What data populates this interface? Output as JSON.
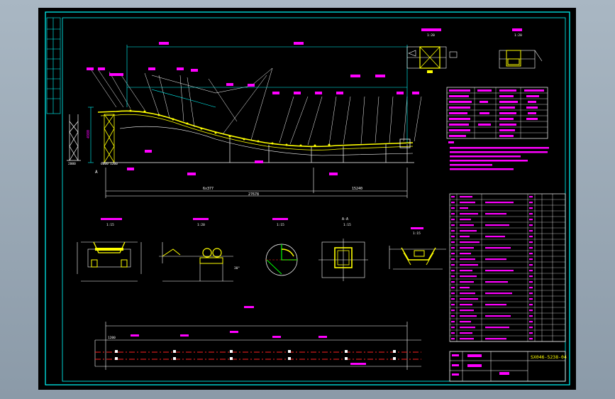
{
  "drawing": {
    "drawing_number": "SX046-5238-04"
  },
  "elevation": {
    "dimensions": {
      "total_length": "27678",
      "left_segment": "6x377",
      "right_segment": "15240",
      "base_left": "6000",
      "base_left2": "1200",
      "left_height": "2000",
      "vertical_height": "4980",
      "bottom_left": "1200"
    },
    "section_marker": "A"
  },
  "details": {
    "top_detail_scale": "1:20",
    "top_right_scale": "1:20",
    "detail_scales": [
      "1:15",
      "1:20",
      "1:15",
      "1:15",
      "1:15"
    ],
    "section_label_aa": "A-A"
  },
  "plan": {
    "left_dim": "1200",
    "angle_mark": "30°"
  },
  "colors": {
    "frame": "#00ffff",
    "parts": "#ffff00",
    "dims": "#ff00ff",
    "lines": "#ffffff",
    "red": "#ff2020",
    "green": "#00ff00"
  }
}
